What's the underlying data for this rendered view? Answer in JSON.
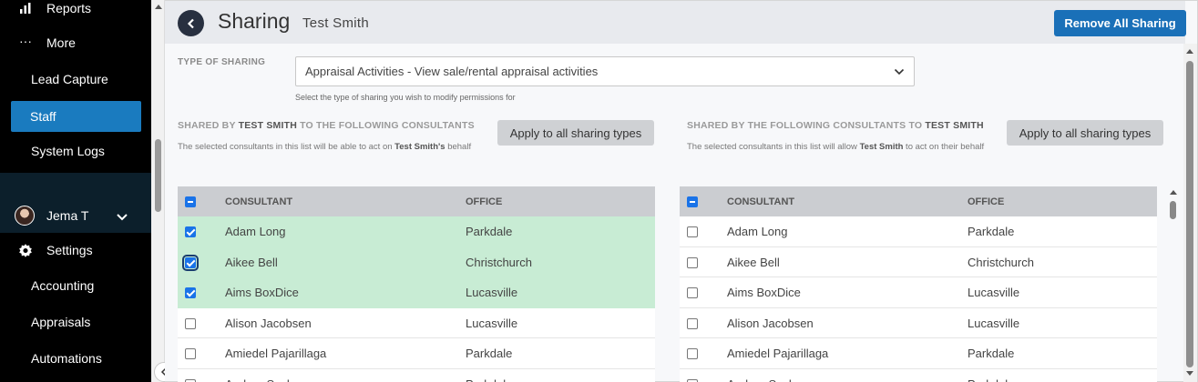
{
  "sidebar": {
    "items": [
      {
        "label": "Reports",
        "icon": "bar-chart-icon"
      },
      {
        "label": "More",
        "icon": "ellipsis-icon"
      },
      {
        "label": "Lead Capture"
      },
      {
        "label": "Staff"
      },
      {
        "label": "System Logs"
      },
      {
        "label": "Jema T",
        "icon": "avatar"
      },
      {
        "label": "Settings",
        "icon": "gear-icon"
      },
      {
        "label": "Accounting"
      },
      {
        "label": "Appraisals"
      },
      {
        "label": "Automations"
      }
    ]
  },
  "header": {
    "title": "Sharing",
    "subtitle": "Test Smith",
    "remove_all_label": "Remove All Sharing"
  },
  "type_of_sharing": {
    "label": "TYPE OF SHARING",
    "selected": "Appraisal Activities - View sale/rental appraisal activities",
    "help": "Select the type of sharing you wish to modify permissions for"
  },
  "left": {
    "title_pre": "SHARED BY ",
    "title_name": "TEST SMITH",
    "title_post": " TO THE FOLLOWING CONSULTANTS",
    "desc_pre": "The selected consultants in this list will be able to act on ",
    "desc_name": "Test Smith's",
    "desc_post": " behalf",
    "apply_label": "Apply to all sharing types",
    "col_consultant": "CONSULTANT",
    "col_office": "OFFICE",
    "rows": [
      {
        "name": "Adam Long",
        "office": "Parkdale",
        "checked": true
      },
      {
        "name": "Aikee Bell",
        "office": "Christchurch",
        "checked": true
      },
      {
        "name": "Aims BoxDice",
        "office": "Lucasville",
        "checked": true
      },
      {
        "name": "Alison Jacobsen",
        "office": "Lucasville",
        "checked": false
      },
      {
        "name": "Amiedel Pajarillaga",
        "office": "Parkdale",
        "checked": false
      },
      {
        "name": "Andrea Sachs",
        "office": "Parkdale",
        "checked": false
      }
    ]
  },
  "right": {
    "title_pre": "SHARED BY THE FOLLOWING CONSULTANTS TO ",
    "title_name": "TEST SMITH",
    "desc_pre": "The selected consultants in this list will allow ",
    "desc_name": "Test Smith",
    "desc_post": " to act on their behalf",
    "apply_label": "Apply to all sharing types",
    "col_consultant": "CONSULTANT",
    "col_office": "OFFICE",
    "rows": [
      {
        "name": "Adam Long",
        "office": "Parkdale",
        "checked": false
      },
      {
        "name": "Aikee Bell",
        "office": "Christchurch",
        "checked": false
      },
      {
        "name": "Aims BoxDice",
        "office": "Lucasville",
        "checked": false
      },
      {
        "name": "Alison Jacobsen",
        "office": "Lucasville",
        "checked": false
      },
      {
        "name": "Amiedel Pajarillaga",
        "office": "Parkdale",
        "checked": false
      },
      {
        "name": "Andrea Sachs",
        "office": "Parkdale",
        "checked": false
      }
    ]
  },
  "colors": {
    "sidebar_bg": "#000000",
    "active_item": "#1a7bbf",
    "primary_button": "#1a70b8",
    "selected_row": "#c8ecd4",
    "checkbox": "#1a73e8"
  }
}
